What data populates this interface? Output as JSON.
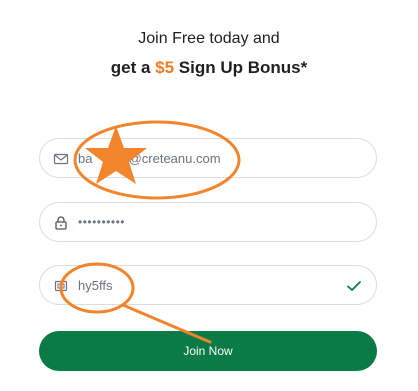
{
  "header": {
    "line1": "Join Free today and",
    "line2_prefix": "get a ",
    "line2_bonus": "$5",
    "line2_suffix": " Sign Up Bonus*"
  },
  "form": {
    "email_value": "ba          @creteanu.com",
    "password_value": "••••••••••",
    "promo_value": "hy5ffs",
    "join_label": "Join Now"
  },
  "icons": {
    "email": "envelope-icon",
    "password": "lock-icon",
    "promo": "tag-icon",
    "valid": "checkmark-icon"
  },
  "colors": {
    "accent": "#f47c27",
    "button": "#0a7a47",
    "check": "#0a7a47"
  }
}
